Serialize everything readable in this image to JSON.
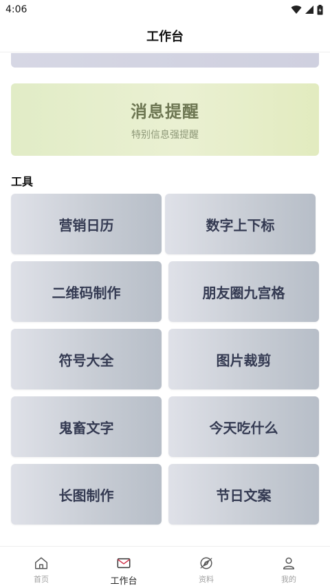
{
  "status_bar": {
    "time": "4:06"
  },
  "header": {
    "title": "工作台"
  },
  "message_card": {
    "title": "消息提醒",
    "subtitle": "特别信息强提醒"
  },
  "tools_section": {
    "title": "工具",
    "items": [
      {
        "label": "营销日历"
      },
      {
        "label": "数字上下标"
      },
      {
        "label": "二维码制作"
      },
      {
        "label": "朋友圈九宫格"
      },
      {
        "label": "符号大全"
      },
      {
        "label": "图片裁剪"
      },
      {
        "label": "鬼畜文字"
      },
      {
        "label": "今天吃什么"
      },
      {
        "label": "长图制作"
      },
      {
        "label": "节日文案"
      }
    ]
  },
  "tab_bar": {
    "items": [
      {
        "label": "首页",
        "icon": "home-icon",
        "active": false
      },
      {
        "label": "工作台",
        "icon": "mail-icon",
        "active": true
      },
      {
        "label": "资料",
        "icon": "compass-icon",
        "active": false
      },
      {
        "label": "我的",
        "icon": "user-icon",
        "active": false
      }
    ]
  },
  "colors": {
    "message_card_title": "#6d7652",
    "tool_text": "#343a52",
    "tab_active": "#222222",
    "tab_inactive": "#a0a0a0",
    "mail_icon_accent": "#d0344c"
  }
}
